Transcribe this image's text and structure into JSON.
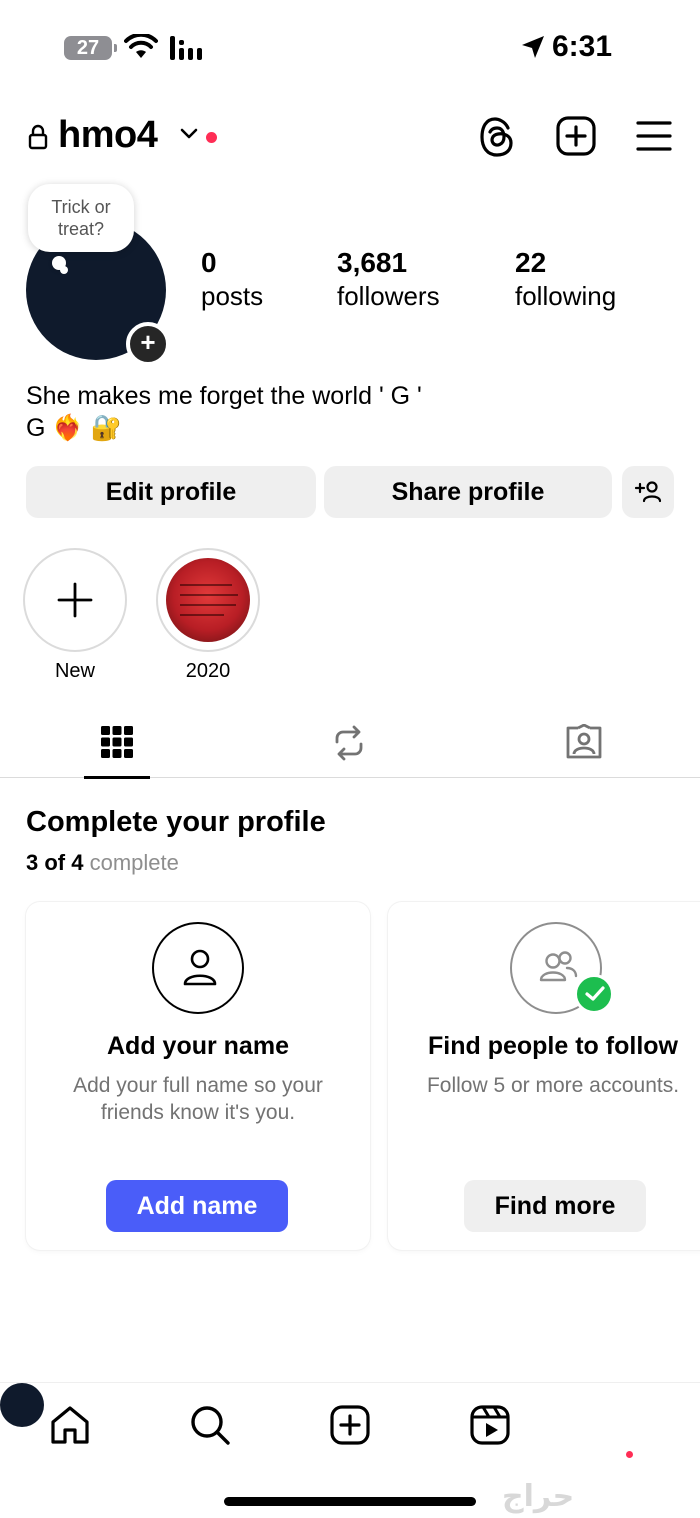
{
  "status_bar": {
    "battery": "27",
    "time": "6:31"
  },
  "header": {
    "username": "hmo4"
  },
  "profile": {
    "note": "Trick or treat?",
    "stats": [
      {
        "num": "0",
        "label": "posts"
      },
      {
        "num": "3,681",
        "label": "followers"
      },
      {
        "num": "22",
        "label": "following"
      }
    ],
    "bio_line1": "She makes me forget the world ' G '",
    "bio_line2": "G ❤️‍🔥 🔐"
  },
  "buttons": {
    "edit": "Edit profile",
    "share": "Share profile"
  },
  "highlights": [
    {
      "label": "New"
    },
    {
      "label": "2020"
    }
  ],
  "complete_profile": {
    "title": "Complete your profile",
    "progress_count": "3 of 4",
    "progress_suffix": "complete",
    "cards": [
      {
        "title": "Add your name",
        "desc": "Add your full name so your friends know it's you.",
        "button": "Add name"
      },
      {
        "title": "Find people to follow",
        "desc": "Follow 5 or more accounts.",
        "button": "Find more"
      }
    ]
  },
  "watermark": "حراج",
  "colors": {
    "accent_blue": "#4a5df9",
    "check_green": "#1dbe4f",
    "notification_red": "#ff2d55"
  }
}
